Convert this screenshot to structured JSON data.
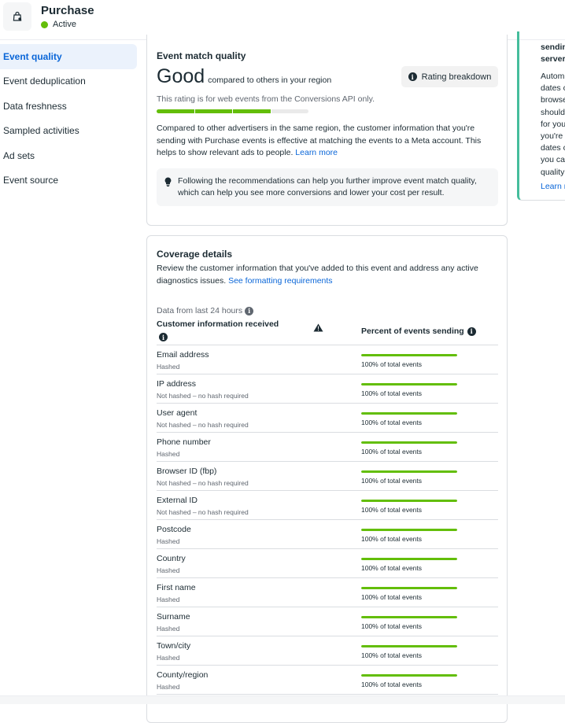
{
  "header": {
    "title": "Purchase",
    "status": "Active",
    "status_color": "#63be09",
    "icon": "shopping-bag-icon"
  },
  "sidebar": {
    "items": [
      {
        "label": "Event quality",
        "active": true
      },
      {
        "label": "Event deduplication",
        "active": false
      },
      {
        "label": "Data freshness",
        "active": false
      },
      {
        "label": "Sampled activities",
        "active": false
      },
      {
        "label": "Ad sets",
        "active": false
      },
      {
        "label": "Event source",
        "active": false
      }
    ]
  },
  "event_match_quality": {
    "title": "Event match quality",
    "rating": "Good",
    "rating_context": "compared to others in your region",
    "rating_button": "Rating breakdown",
    "note": "This rating is for web events from the Conversions API only.",
    "segments_filled": 3,
    "segments_total": 4,
    "description": "Compared to other advertisers in the same region, the customer information that you're sending with Purchase events is effective at matching the events to a Meta account. This helps to show relevant ads to people.",
    "learn_more": "Learn more",
    "tip": "Following the recommendations can help you further improve event match quality, which can help you see more conversions and lower your cost per result."
  },
  "coverage": {
    "title": "Coverage details",
    "description": "Review the customer information that you've added to this event and address any active diagnostics issues.",
    "link": "See formatting requirements",
    "data_from": "Data from last 24 hours",
    "col1": "Customer information received",
    "col2": "Percent of events sending",
    "rows": [
      {
        "name": "Email address",
        "sub": "Hashed",
        "percent": 100,
        "pct_label": "100% of total events"
      },
      {
        "name": "IP address",
        "sub": "Not hashed – no hash required",
        "percent": 100,
        "pct_label": "100% of total events"
      },
      {
        "name": "User agent",
        "sub": "Not hashed – no hash required",
        "percent": 100,
        "pct_label": "100% of total events"
      },
      {
        "name": "Phone number",
        "sub": "Hashed",
        "percent": 100,
        "pct_label": "100% of total events"
      },
      {
        "name": "Browser ID (fbp)",
        "sub": "Not hashed – no hash required",
        "percent": 100,
        "pct_label": "100% of total events"
      },
      {
        "name": "External ID",
        "sub": "Not hashed – no hash required",
        "percent": 100,
        "pct_label": "100% of total events"
      },
      {
        "name": "Postcode",
        "sub": "Hashed",
        "percent": 100,
        "pct_label": "100% of total events"
      },
      {
        "name": "Country",
        "sub": "Hashed",
        "percent": 100,
        "pct_label": "100% of total events"
      },
      {
        "name": "First name",
        "sub": "Hashed",
        "percent": 100,
        "pct_label": "100% of total events"
      },
      {
        "name": "Surname",
        "sub": "Hashed",
        "percent": 100,
        "pct_label": "100% of total events"
      },
      {
        "name": "Town/city",
        "sub": "Hashed",
        "percent": 100,
        "pct_label": "100% of total events"
      },
      {
        "name": "County/region",
        "sub": "Hashed",
        "percent": 100,
        "pct_label": "100% of total events"
      }
    ]
  },
  "right_panel": {
    "title_lines": [
      "sendin",
      "server"
    ],
    "body_lines": [
      "Autom",
      "dates c",
      "browse",
      "should",
      "for you",
      "you're",
      "dates c",
      "you ca",
      "quality"
    ],
    "link": "Learn r",
    "accent": "#45bd9c"
  }
}
